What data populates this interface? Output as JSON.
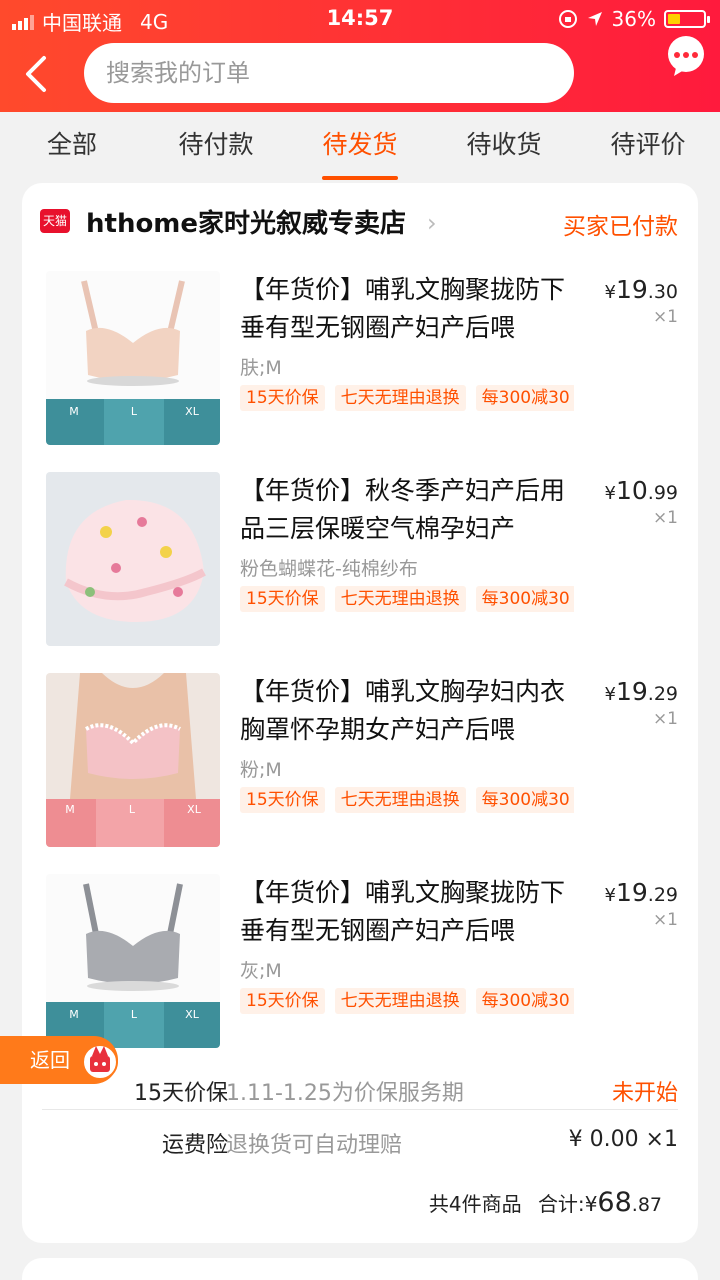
{
  "status_bar": {
    "carrier": "中国联通",
    "network": "4G",
    "time": "14:57",
    "battery": "36%",
    "battery_level": 0.36
  },
  "search": {
    "placeholder": "搜索我的订单"
  },
  "tabs": [
    {
      "label": "全部"
    },
    {
      "label": "待付款"
    },
    {
      "label": "待发货",
      "active": true
    },
    {
      "label": "待收货"
    },
    {
      "label": "待评价"
    }
  ],
  "shop": {
    "badge": "天猫",
    "name": "hthome家时光叙威专卖店",
    "status": "买家已付款"
  },
  "items": [
    {
      "title": "【年货价】哺乳文胸聚拢防下垂有型无钢圈产妇产后喂",
      "sku": "肤;M",
      "yen": "¥",
      "price_int": "19",
      "price_dec": ".30",
      "qty": "×1",
      "tags": [
        "15天价保",
        "七天无理由退换",
        "每300减30"
      ],
      "image": "nude-nursing-bra"
    },
    {
      "title": "【年货价】秋冬季产妇产后用品三层保暖空气棉孕妇产",
      "sku": "粉色蝴蝶花-纯棉纱布",
      "yen": "¥",
      "price_int": "10",
      "price_dec": ".99",
      "qty": "×1",
      "tags": [
        "15天价保",
        "七天无理由退换",
        "每300减30"
      ],
      "image": "floral-confinement-hat"
    },
    {
      "title": "【年货价】哺乳文胸孕妇内衣胸罩怀孕期女产妇产后喂",
      "sku": "粉;M",
      "yen": "¥",
      "price_int": "19",
      "price_dec": ".29",
      "qty": "×1",
      "tags": [
        "15天价保",
        "七天无理由退换",
        "每300减30"
      ],
      "image": "pink-lace-bra"
    },
    {
      "title": "【年货价】哺乳文胸聚拢防下垂有型无钢圈产妇产后喂",
      "sku": "灰;M",
      "yen": "¥",
      "price_int": "19",
      "price_dec": ".29",
      "qty": "×1",
      "tags": [
        "15天价保",
        "七天无理由退换",
        "每300减30"
      ],
      "image": "grey-nursing-bra"
    }
  ],
  "size_labels": [
    "M",
    "L",
    "XL"
  ],
  "price_guarantee": {
    "label": "15天价保",
    "desc": "1.11-1.25为价保服务期",
    "value": "未开始"
  },
  "shipping_insurance": {
    "label": "运费险",
    "desc": "退换货可自动理赔",
    "value": "¥ 0.00 ×1"
  },
  "total": {
    "count": "共4件商品",
    "label": "合计:",
    "yen": "¥",
    "int": "68",
    "dec": ".87"
  },
  "return_button": {
    "label": "返回"
  },
  "colors": {
    "accent": "#ff5000",
    "header_start": "#ff4a2c",
    "header_end": "#ff1a3d",
    "tmall": "#e8112d"
  }
}
